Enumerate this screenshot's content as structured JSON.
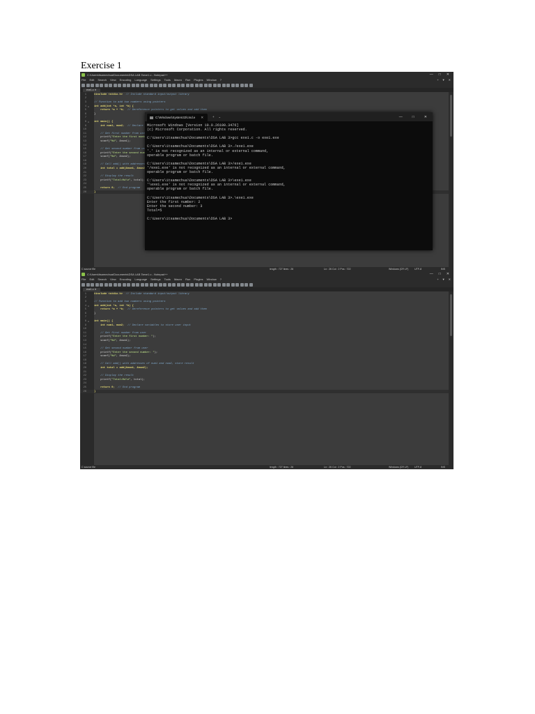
{
  "heading": "Exercise 1",
  "notepad": {
    "window_title": "C:\\Users\\itsamechua\\Documents\\DSA LAB 3\\exe1.c - Notepad++",
    "window_controls": [
      "—",
      "□",
      "✕"
    ],
    "menu": [
      "File",
      "Edit",
      "Search",
      "View",
      "Encoding",
      "Language",
      "Settings",
      "Tools",
      "Macro",
      "Run",
      "Plugins",
      "Window",
      "?"
    ],
    "menu_right": [
      "+",
      "▼",
      "✕"
    ],
    "tab_label": "exe1.c ✕",
    "status": {
      "file_type": "C source file",
      "length": "length : 727    lines : 26",
      "position": "Ln : 26    Col : 2    Pos : 722",
      "eol": "Windows (CR LF)",
      "encoding": "UTF-8",
      "mode": "INS"
    },
    "code_lines": [
      {
        "n": "1",
        "fold": "",
        "parts": [
          {
            "t": "#include <stdio.h>",
            "c": "kw"
          },
          {
            "t": "  // Include standard input/output library",
            "c": "cm"
          }
        ]
      },
      {
        "n": "2",
        "fold": "",
        "parts": []
      },
      {
        "n": "3",
        "fold": "",
        "parts": [
          {
            "t": "// Function to add two numbers using pointers",
            "c": "cm"
          }
        ]
      },
      {
        "n": "4",
        "fold": "⊟",
        "parts": [
          {
            "t": "int add(int *a, int *b) {",
            "c": "kw"
          }
        ]
      },
      {
        "n": "5",
        "fold": "",
        "parts": [
          {
            "t": "    return *a + *b;",
            "c": "kw"
          },
          {
            "t": "  // Dereference pointers to get values and add them",
            "c": "cm"
          }
        ]
      },
      {
        "n": "6",
        "fold": "",
        "parts": [
          {
            "t": "}",
            "c": "txt"
          }
        ]
      },
      {
        "n": "7",
        "fold": "",
        "parts": []
      },
      {
        "n": "8",
        "fold": "⊟",
        "parts": [
          {
            "t": "int main() {",
            "c": "kw"
          }
        ]
      },
      {
        "n": "9",
        "fold": "",
        "parts": [
          {
            "t": "    int num1, num2;",
            "c": "kw"
          },
          {
            "t": "  // Declare variables to store user input",
            "c": "cm"
          }
        ]
      },
      {
        "n": "10",
        "fold": "",
        "parts": []
      },
      {
        "n": "11",
        "fold": "",
        "parts": [
          {
            "t": "    // Get first number from user",
            "c": "cm"
          }
        ]
      },
      {
        "n": "12",
        "fold": "",
        "parts": [
          {
            "t": "    printf(",
            "c": "txt"
          },
          {
            "t": "\"Enter the first number: \"",
            "c": "str"
          },
          {
            "t": ");",
            "c": "txt"
          }
        ]
      },
      {
        "n": "13",
        "fold": "",
        "parts": [
          {
            "t": "    scanf(",
            "c": "txt"
          },
          {
            "t": "\"%d\"",
            "c": "str"
          },
          {
            "t": ", &num1);",
            "c": "txt"
          }
        ]
      },
      {
        "n": "14",
        "fold": "",
        "parts": []
      },
      {
        "n": "15",
        "fold": "",
        "parts": [
          {
            "t": "    // Get second number from user",
            "c": "cm"
          }
        ]
      },
      {
        "n": "16",
        "fold": "",
        "parts": [
          {
            "t": "    printf(",
            "c": "txt"
          },
          {
            "t": "\"Enter the second number: \"",
            "c": "str"
          },
          {
            "t": ");",
            "c": "txt"
          }
        ]
      },
      {
        "n": "17",
        "fold": "",
        "parts": [
          {
            "t": "    scanf(",
            "c": "txt"
          },
          {
            "t": "\"%d\"",
            "c": "str"
          },
          {
            "t": ", &num2);",
            "c": "txt"
          }
        ]
      },
      {
        "n": "18",
        "fold": "",
        "parts": []
      },
      {
        "n": "19",
        "fold": "",
        "parts": [
          {
            "t": "    // Call add() with addresses of num1 and num2, store result",
            "c": "cm"
          }
        ]
      },
      {
        "n": "20",
        "fold": "",
        "parts": [
          {
            "t": "    int total = add(&num1, &num2);",
            "c": "kw"
          }
        ]
      },
      {
        "n": "21",
        "fold": "",
        "parts": []
      },
      {
        "n": "22",
        "fold": "",
        "parts": [
          {
            "t": "    // Display the result",
            "c": "cm"
          }
        ]
      },
      {
        "n": "23",
        "fold": "",
        "parts": [
          {
            "t": "    printf(",
            "c": "txt"
          },
          {
            "t": "\"Total=%d\\n\"",
            "c": "str"
          },
          {
            "t": ", total);",
            "c": "txt"
          }
        ]
      },
      {
        "n": "24",
        "fold": "",
        "parts": []
      },
      {
        "n": "25",
        "fold": "",
        "parts": [
          {
            "t": "    return 0;",
            "c": "kw"
          },
          {
            "t": "  // End program",
            "c": "cm"
          }
        ]
      },
      {
        "n": "26",
        "fold": "",
        "parts": [
          {
            "t": "}",
            "c": "kw"
          }
        ]
      }
    ]
  },
  "terminal": {
    "tab_title": "C:\\Windows\\System32\\cmd.e",
    "tab_close": "✕",
    "add": "+",
    "dropdown": "⌄",
    "controls": [
      "—",
      "□",
      "✕"
    ],
    "lines": [
      "Microsoft Windows [Version 10.0.26100.3476]",
      "(c) Microsoft Corporation. All rights reserved.",
      "",
      "C:\\Users\\itsamechua\\Documents\\DSA LAB 3>gcc exe1.c -o exe1.exe",
      "",
      "C:\\Users\\itsamechua\\Documents\\DSA LAB 3>./exe1.exe",
      "'.' is not recognized as an internal or external command,",
      "operable program or batch file.",
      "",
      "C:\\Users\\itsamechua\\Documents\\DSA LAB 3>/exe1.exe",
      "'/exe1.exe' is not recognized as an internal or external command,",
      "operable program or batch file.",
      "",
      "C:\\Users\\itsamechua\\Documents\\DSA LAB 3>\\exe1.exe",
      "'\\exe1.exe' is not recognized as an internal or external command,",
      "operable program or batch file.",
      "",
      "C:\\Users\\itsamechua\\Documents\\DSA LAB 3>.\\exe1.exe",
      "Enter the first number: 2",
      "Enter the second number: 3",
      "Total=5",
      "",
      "C:\\Users\\itsamechua\\Documents\\DSA LAB 3>"
    ]
  }
}
